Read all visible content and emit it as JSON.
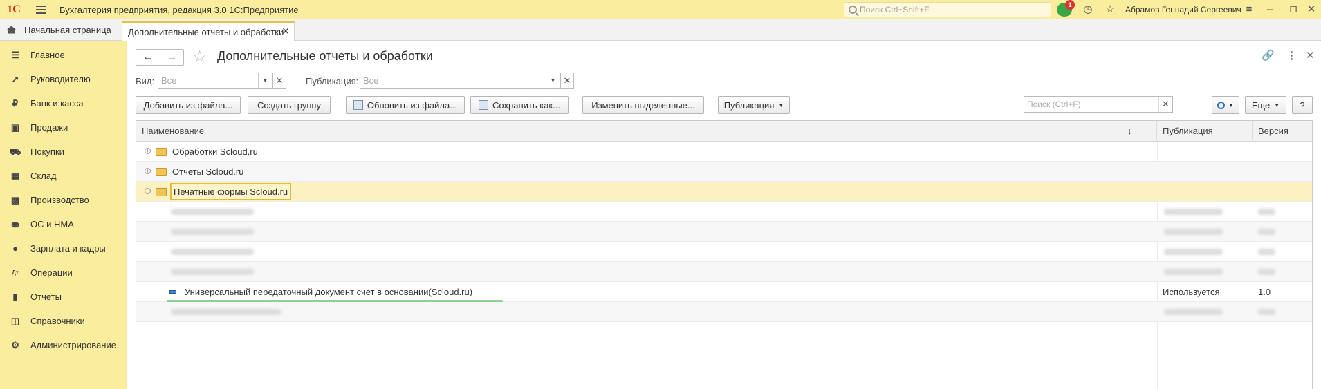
{
  "titlebar": {
    "logo": "1С",
    "app_title": "Бухгалтерия предприятия, редакция 3.0 1С:Предприятие",
    "search_placeholder": "Поиск Ctrl+Shift+F",
    "notification_count": "1",
    "user_name": "Абрамов Геннадий Сергеевич"
  },
  "tabs": {
    "home_label": "Начальная страница",
    "active_label": "Дополнительные отчеты и обработки"
  },
  "sidebar": {
    "items": [
      {
        "label": "Главное",
        "icon": "menu-icon"
      },
      {
        "label": "Руководителю",
        "icon": "trend-icon"
      },
      {
        "label": "Банк и касса",
        "icon": "ruble-icon"
      },
      {
        "label": "Продажи",
        "icon": "bag-icon"
      },
      {
        "label": "Покупки",
        "icon": "cart-icon"
      },
      {
        "label": "Склад",
        "icon": "warehouse-icon"
      },
      {
        "label": "Производство",
        "icon": "factory-icon"
      },
      {
        "label": "ОС и НМА",
        "icon": "truck-icon"
      },
      {
        "label": "Зарплата и кадры",
        "icon": "person-icon"
      },
      {
        "label": "Операции",
        "icon": "dt-kt-icon"
      },
      {
        "label": "Отчеты",
        "icon": "chart-icon"
      },
      {
        "label": "Справочники",
        "icon": "book-icon"
      },
      {
        "label": "Администрирование",
        "icon": "gear-icon"
      }
    ]
  },
  "main": {
    "title": "Дополнительные отчеты и обработки",
    "filters": {
      "kind_label": "Вид:",
      "kind_value": "Все",
      "publication_label": "Публикация:",
      "publication_value": "Все"
    },
    "toolbar": {
      "add_from_file": "Добавить из файла...",
      "create_group": "Создать группу",
      "update_from_file": "Обновить из файла...",
      "save_as": "Сохранить как...",
      "change_selected": "Изменить выделенные...",
      "publication": "Публикация",
      "search_placeholder": "Поиск (Ctrl+F)",
      "more": "Еще",
      "help": "?"
    },
    "table": {
      "headers": {
        "name": "Наименование",
        "publication": "Публикация",
        "version": "Версия"
      },
      "groups": [
        {
          "name": "Обработки Scloud.ru",
          "expanded": false
        },
        {
          "name": "Отчеты Scloud.ru",
          "expanded": false
        },
        {
          "name": "Печатные формы Scloud.ru",
          "expanded": true
        }
      ],
      "visible_item": {
        "name": "Универсальный передаточный документ счет в основании(Scloud.ru)",
        "publication": "Используется",
        "version": "1.0"
      }
    }
  }
}
